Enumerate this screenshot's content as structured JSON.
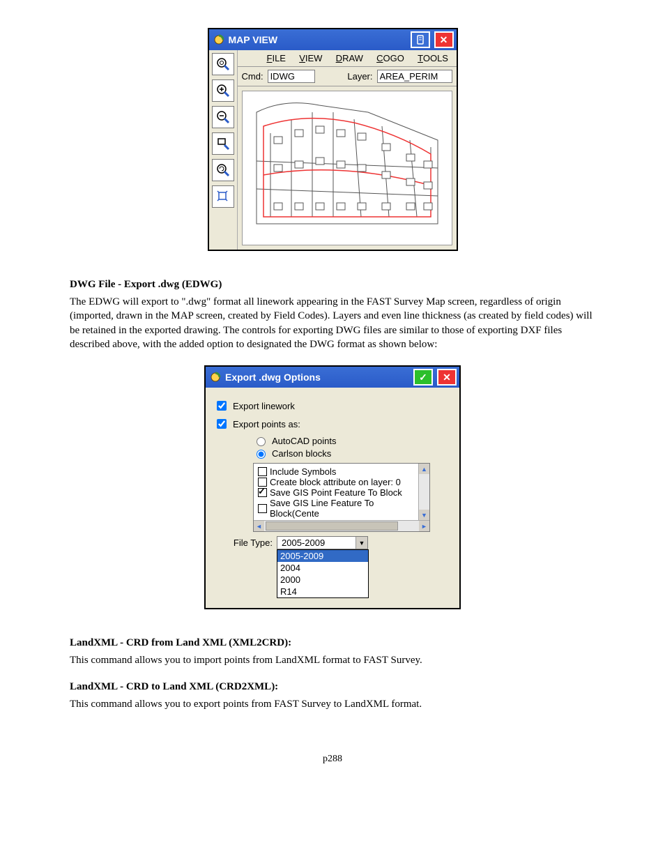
{
  "map_window": {
    "title": "MAP VIEW",
    "menu": {
      "file": "FILE",
      "view": "VIEW",
      "draw": "DRAW",
      "cogo": "COGO",
      "tools": "TOOLS"
    },
    "cmd_label": "Cmd:",
    "cmd_value": "IDWG",
    "layer_label": "Layer:",
    "layer_value": "AREA_PERIM"
  },
  "section1": {
    "heading": "DWG File - Export .dwg (EDWG)",
    "body": "The EDWG will export to \".dwg\" format all linework appearing in the FAST Survey Map screen, regardless of origin (imported, drawn in the MAP screen, created by Field Codes).  Layers and even line thickness (as created by field codes) will be retained in the exported drawing.  The controls for exporting DWG files are similar to those of exporting DXF files described above, with the added option to designated the DWG format as shown below:"
  },
  "export_dialog": {
    "title": "Export .dwg Options",
    "export_linework": "Export linework",
    "export_points_as": "Export points as:",
    "opt_autocad": "AutoCAD points",
    "opt_carlson": "Carlson blocks",
    "list": {
      "include_symbols": "Include Symbols",
      "create_block_attr": "Create block attribute on layer: 0",
      "save_gis_point": "Save GIS Point Feature To Block",
      "save_gis_line": "Save GIS Line Feature To Block(Cente"
    },
    "file_type_label": "File Type:",
    "file_type_value": "2005-2009",
    "dropdown": {
      "o0": "2005-2009",
      "o1": "2004",
      "o2": "2000",
      "o3": "R14"
    }
  },
  "section2": {
    "heading": "LandXML - CRD from Land XML (XML2CRD):",
    "body": "This command allows you to import points from LandXML format to FAST Survey."
  },
  "section3": {
    "heading": "LandXML - CRD to Land XML (CRD2XML):",
    "body": "This command allows you to export points from FAST Survey to LandXML format."
  },
  "page_number": "p288"
}
